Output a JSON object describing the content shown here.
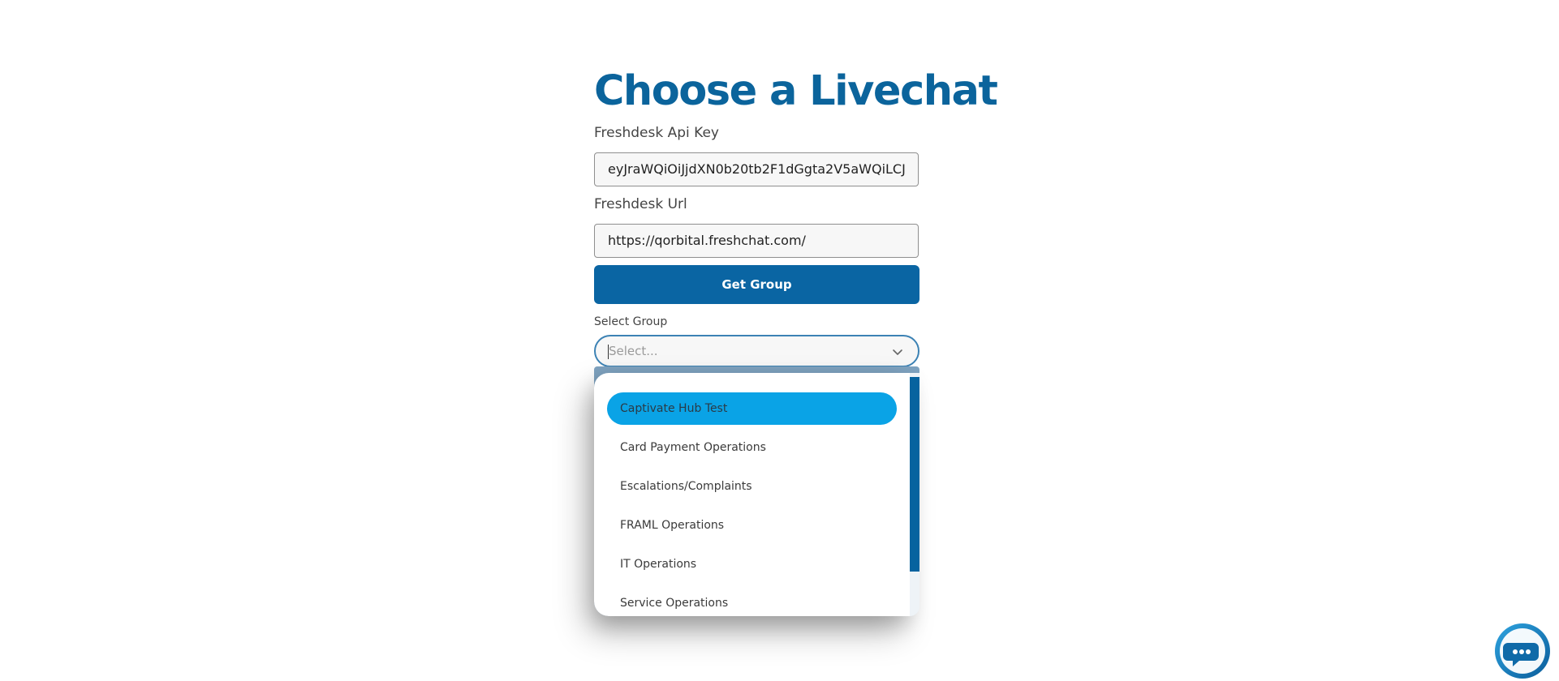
{
  "page": {
    "title": "Choose a Livechat"
  },
  "form": {
    "api_key_label": "Freshdesk Api Key",
    "api_key_value": "eyJraWQiOiJjdXN0b20tb2F1dGgta2V5aWQiLCJ",
    "url_label": "Freshdesk Url",
    "url_value": "https://qorbital.freshchat.com/",
    "get_group_button": "Get Group",
    "select_group_label": "Select Group",
    "select_placeholder": "Select..."
  },
  "dropdown": {
    "options": [
      {
        "label": "Captivate Hub Test",
        "selected": true
      },
      {
        "label": "Card Payment Operations",
        "selected": false
      },
      {
        "label": "Escalations/Complaints",
        "selected": false
      },
      {
        "label": "FRAML Operations",
        "selected": false
      },
      {
        "label": "IT Operations",
        "selected": false
      },
      {
        "label": "Service Operations",
        "selected": false
      }
    ]
  },
  "colors": {
    "brand": "#0b649c",
    "button": "#0a65a3",
    "selected_option": "#0aa3e6"
  },
  "icons": {
    "select_chevron": "chevron-down-icon",
    "chat_widget": "chat-bubble-icon"
  }
}
